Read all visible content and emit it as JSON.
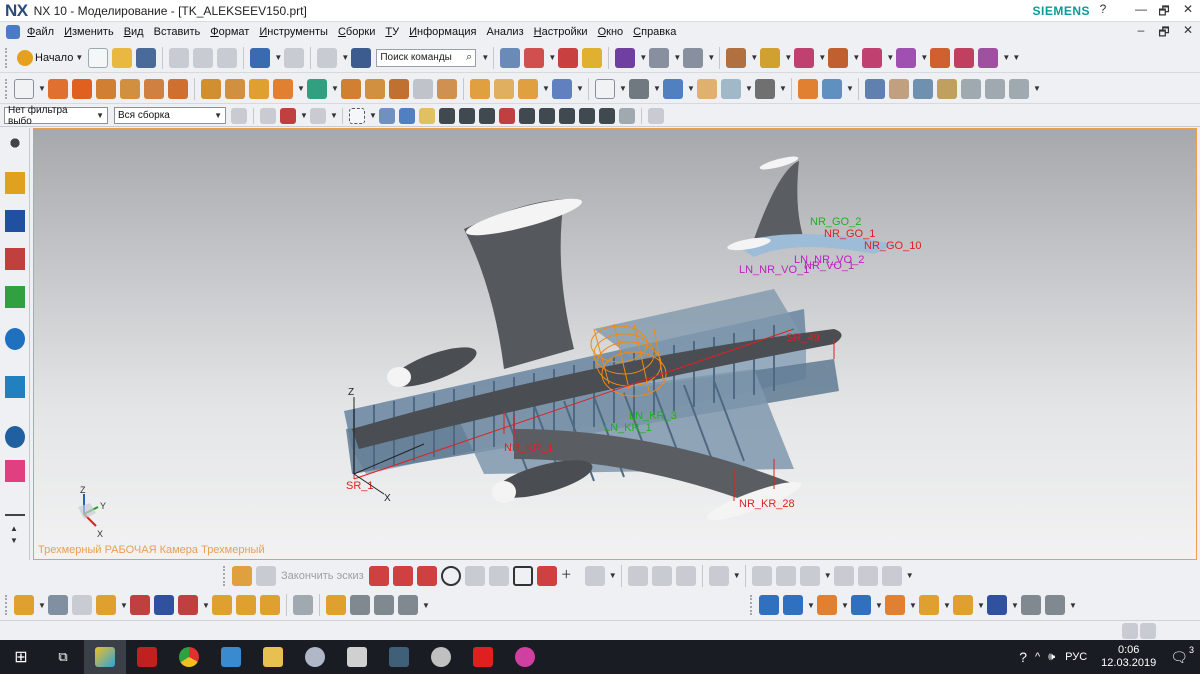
{
  "window": {
    "logo": "NX",
    "title": "NX 10 - Моделирование - [TK_ALEKSEEV150.prt]",
    "brand": "SIEMENS",
    "controls": [
      "?",
      "—",
      "🗗",
      "✕"
    ]
  },
  "menu": {
    "items": [
      {
        "ul": "Ф",
        "rest": "айл"
      },
      {
        "ul": "И",
        "rest": "зменить"
      },
      {
        "ul": "В",
        "rest": "ид"
      },
      {
        "ul": "",
        "rest": "Вставить"
      },
      {
        "ul": "Ф",
        "rest": "ормат"
      },
      {
        "ul": "И",
        "rest": "нструменты"
      },
      {
        "ul": "С",
        "rest": "борки"
      },
      {
        "ul": "Т",
        "rest": "У"
      },
      {
        "ul": "И",
        "rest": "нформация"
      },
      {
        "ul": "",
        "rest": "Анализ"
      },
      {
        "ul": "Н",
        "rest": "астройки"
      },
      {
        "ul": "О",
        "rest": "кно"
      },
      {
        "ul": "С",
        "rest": "правка"
      }
    ],
    "right_controls": [
      "–",
      "🗗",
      "✕"
    ]
  },
  "toolbar1": {
    "start_label": "Начало",
    "search_placeholder": "Поиск команды"
  },
  "toolbar3": {
    "filter_label": "Нет фильтра выбо",
    "assembly_label": "Вся сборка"
  },
  "viewport": {
    "label": "Трехмерный РАБОЧАЯ Камера Трехмерный",
    "annotations": [
      "NR_GO_2",
      "NR_GO_10",
      "LN_NR_VO_2",
      "LN_NR_VO_1",
      "LN_KR_3",
      "LN_KR_1",
      "NR_KR_1",
      "NR_KR_28",
      "NR_GO_1",
      "NR_VO_1",
      "SR_1",
      "SR_49"
    ],
    "axes": {
      "x": "X",
      "y": "Y",
      "z": "Z"
    }
  },
  "bottom_toolbar": {
    "finish_sketch_label": "Закончить эскиз"
  },
  "taskbar": {
    "lang": "РУС",
    "time": "0:06",
    "date": "12.03.2019",
    "notification_count": "3"
  },
  "colors": {
    "accent_orange": "#e8a050",
    "annotation_red": "#e02020",
    "annotation_green": "#20b020",
    "annotation_magenta": "#c020c0",
    "brand_teal": "#0a9a9a"
  }
}
